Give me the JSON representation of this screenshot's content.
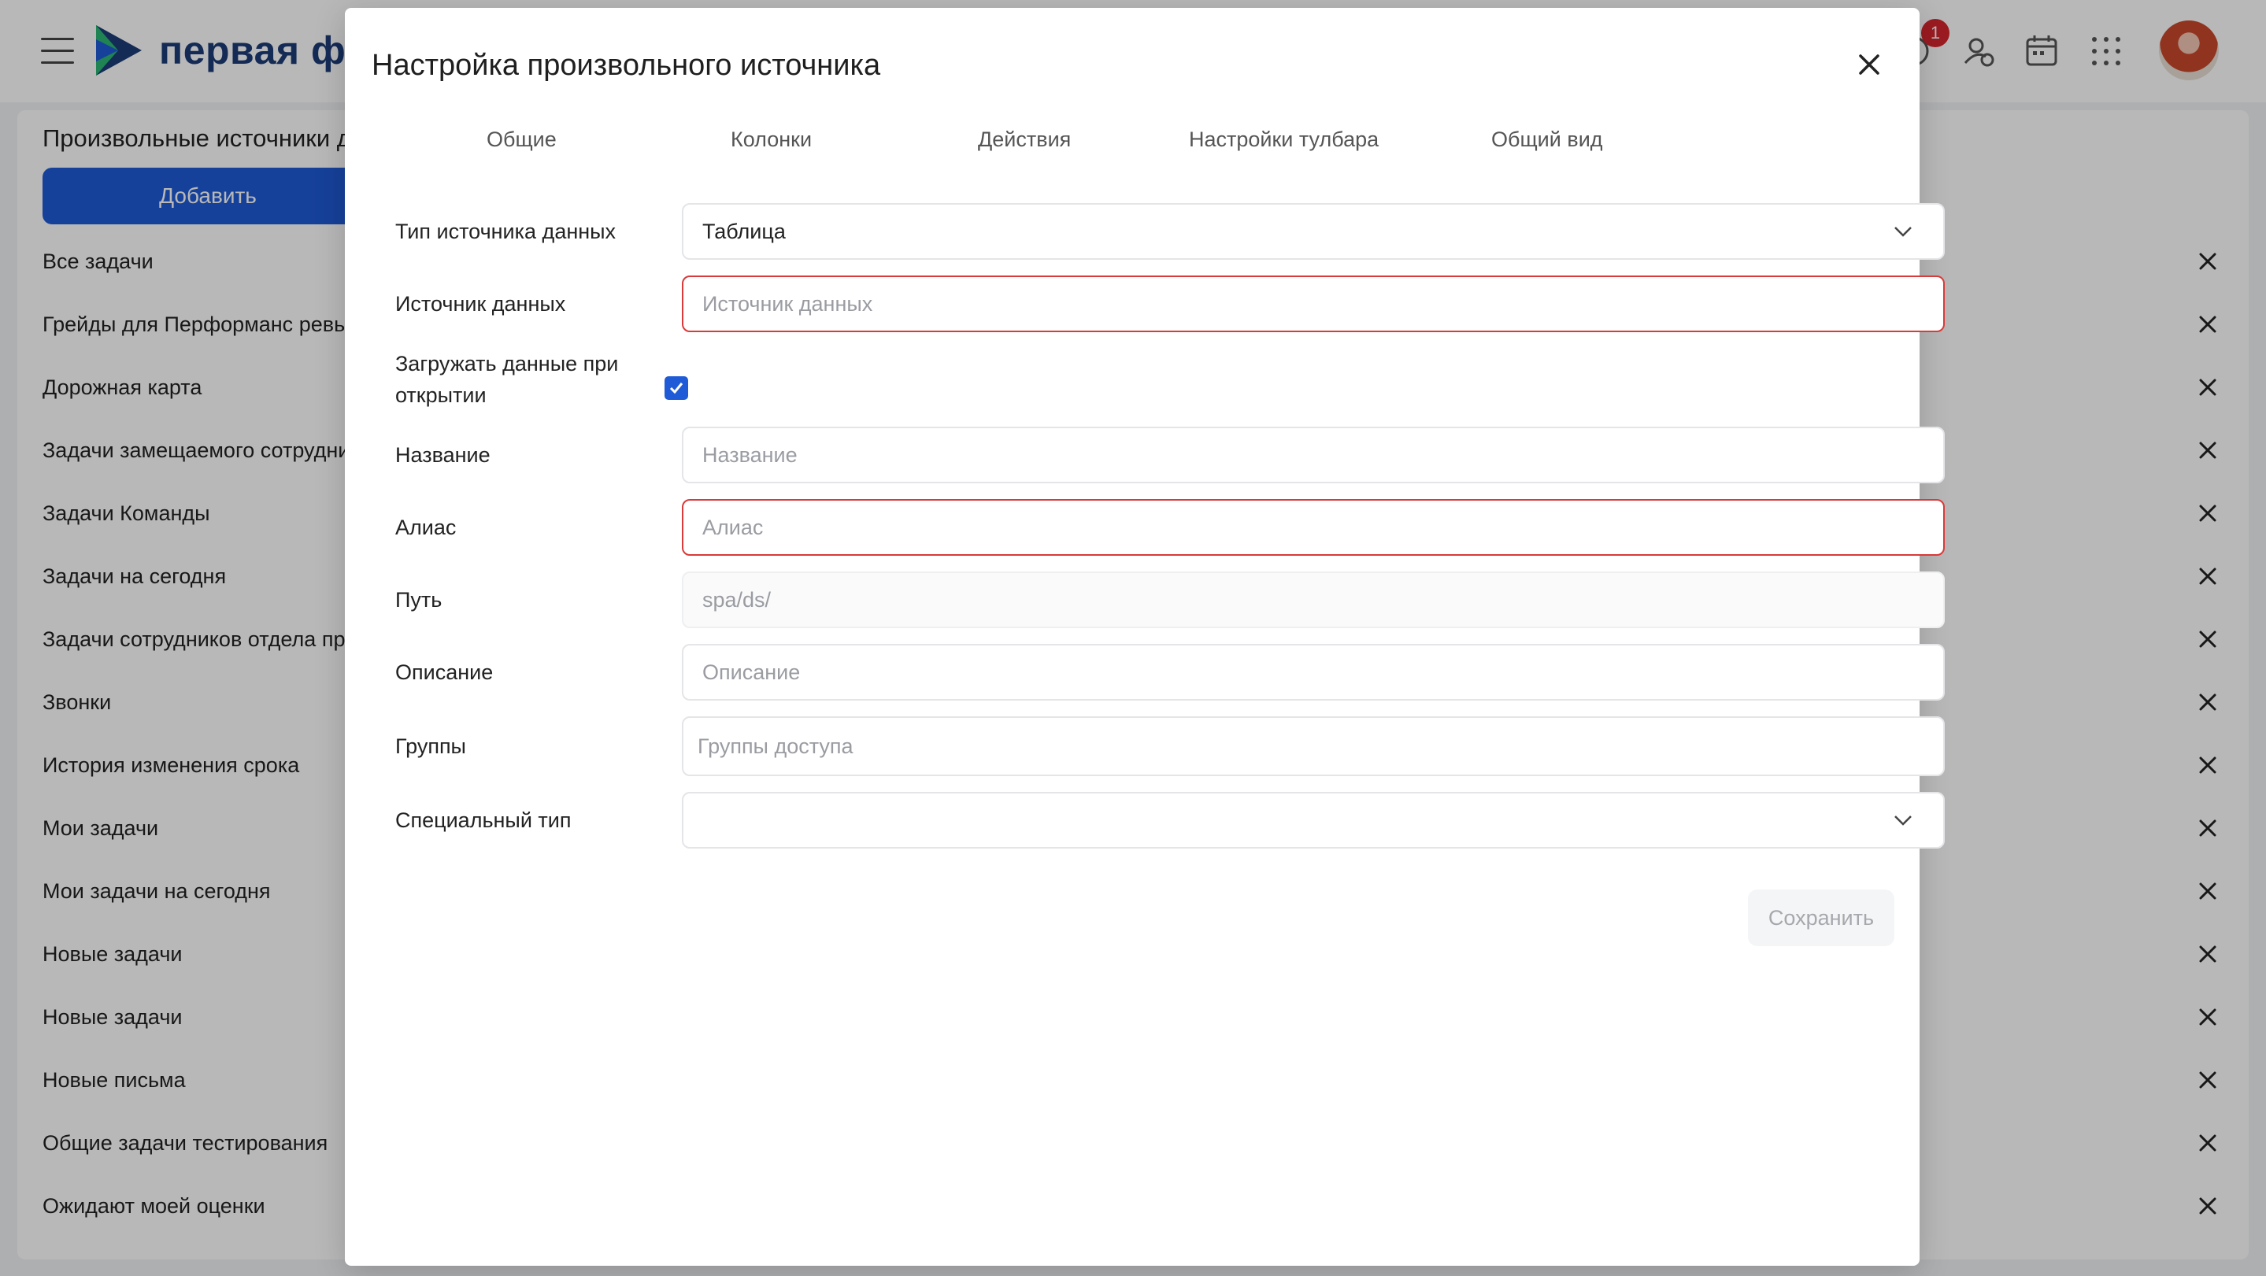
{
  "brand": {
    "name": "первая фор"
  },
  "header": {
    "notifications_count": "1"
  },
  "sources_panel": {
    "title": "Произвольные источники д",
    "add_label": "Добавить",
    "items": [
      "Все задачи",
      "Грейды для Перформанс ревью",
      "Дорожная карта",
      "Задачи замещаемого сотрудника",
      "Задачи Команды",
      "Задачи на сегодня",
      "Задачи сотрудников отдела пр",
      "Звонки",
      "История изменения срока",
      "Мои задачи",
      "Мои задачи на сегодня",
      "Новые задачи",
      "Новые задачи",
      "Новые письма",
      "Общие задачи тестирования",
      "Ожидают моей оценки"
    ]
  },
  "modal": {
    "title": "Настройка произвольного источника",
    "tabs": [
      "Общие",
      "Колонки",
      "Действия",
      "Настройки тулбара",
      "Общий вид"
    ],
    "form": {
      "source_type_label": "Тип источника данных",
      "source_type_value": "Таблица",
      "data_source_label": "Источник данных",
      "data_source_placeholder": "Источник данных",
      "load_on_open_label_1": "Загружать данные при",
      "load_on_open_label_2": "открытии",
      "load_on_open_checked": true,
      "name_label": "Название",
      "name_placeholder": "Название",
      "alias_label": "Алиас",
      "alias_placeholder": "Алиас",
      "path_label": "Путь",
      "path_placeholder": "spa/ds/",
      "description_label": "Описание",
      "description_placeholder": "Описание",
      "groups_label": "Группы",
      "groups_placeholder": "Группы доступа",
      "special_type_label": "Специальный тип",
      "special_type_value": ""
    },
    "save_label": "Сохранить"
  },
  "colors": {
    "accent": "#1f5bd6",
    "error_border": "#d93a3a",
    "brand_text": "#1d3c78"
  }
}
